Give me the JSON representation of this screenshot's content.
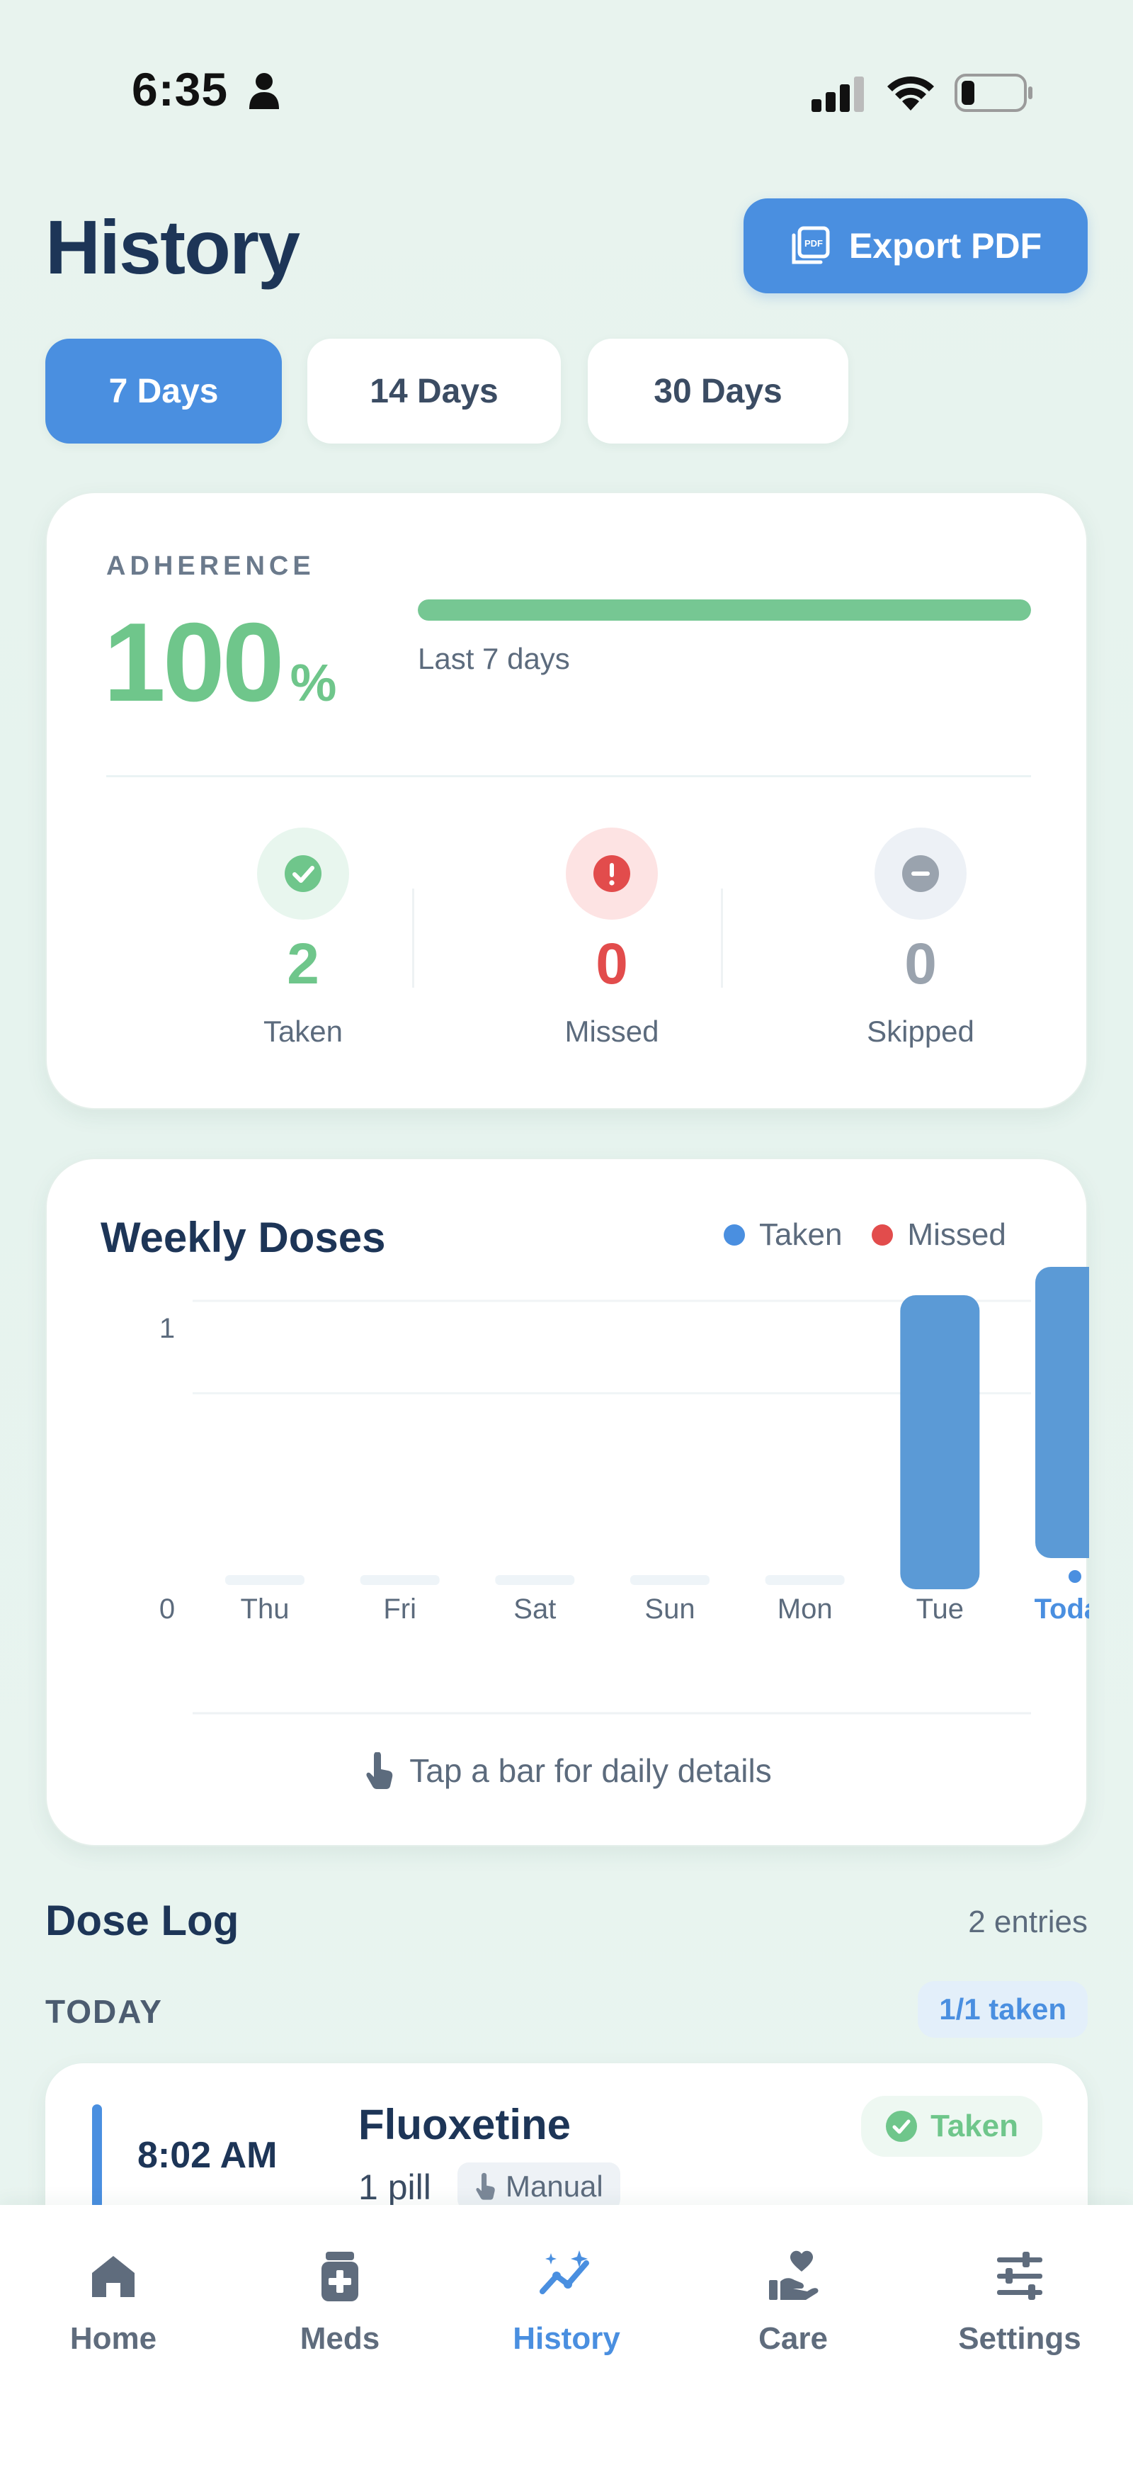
{
  "status_bar": {
    "time": "6:35"
  },
  "header": {
    "title": "History",
    "export_label": "Export PDF"
  },
  "range_tabs": [
    {
      "label": "7 Days",
      "active": true
    },
    {
      "label": "14 Days",
      "active": false
    },
    {
      "label": "30 Days",
      "active": false
    }
  ],
  "adherence": {
    "label": "ADHERENCE",
    "value": "100",
    "unit": "%",
    "progress_percent": 100,
    "period": "Last 7 days",
    "stats": [
      {
        "value": "2",
        "label": "Taken",
        "color": "#6fc68b",
        "bg": "#e8f6ee",
        "icon": "check-circle-icon"
      },
      {
        "value": "0",
        "label": "Missed",
        "color": "#e24c4c",
        "bg": "#fde3e3",
        "icon": "alert-circle-icon"
      },
      {
        "value": "0",
        "label": "Skipped",
        "color": "#9aa3ae",
        "bg": "#edf1f6",
        "icon": "minus-circle-icon"
      }
    ]
  },
  "weekly_chart": {
    "title": "Weekly Doses",
    "hint": "Tap a bar for daily details",
    "legend": [
      {
        "label": "Taken",
        "color": "#4a8fe0"
      },
      {
        "label": "Missed",
        "color": "#e24c4c"
      }
    ]
  },
  "chart_data": {
    "type": "bar",
    "categories": [
      "Thu",
      "Fri",
      "Sat",
      "Sun",
      "Mon",
      "Tue",
      "Today"
    ],
    "series": [
      {
        "name": "Taken",
        "values": [
          0,
          0,
          0,
          0,
          0,
          1,
          1
        ]
      },
      {
        "name": "Missed",
        "values": [
          0,
          0,
          0,
          0,
          0,
          0,
          0
        ]
      }
    ],
    "yticks": [
      "0",
      "1"
    ],
    "ylim": [
      0,
      1
    ],
    "highlight_category": "Today",
    "grid": true
  },
  "dose_log": {
    "title": "Dose Log",
    "entries_count": "2 entries",
    "day_label": "TODAY",
    "day_badge": "1/1 taken",
    "entries": [
      {
        "time": "8:02 AM",
        "medication": "Fluoxetine",
        "dose": "1 pill",
        "source": "Manual",
        "status": "Taken"
      }
    ]
  },
  "bottom_nav": [
    {
      "label": "Home",
      "icon": "home-icon",
      "active": false
    },
    {
      "label": "Meds",
      "icon": "medicine-box-icon",
      "active": false
    },
    {
      "label": "History",
      "icon": "trend-icon",
      "active": true
    },
    {
      "label": "Care",
      "icon": "care-heart-hand-icon",
      "active": false
    },
    {
      "label": "Settings",
      "icon": "sliders-icon",
      "active": false
    }
  ],
  "colors": {
    "accent": "#4a8fe0",
    "success": "#6fc68b",
    "danger": "#e24c4c",
    "muted": "#9aa3ae"
  }
}
